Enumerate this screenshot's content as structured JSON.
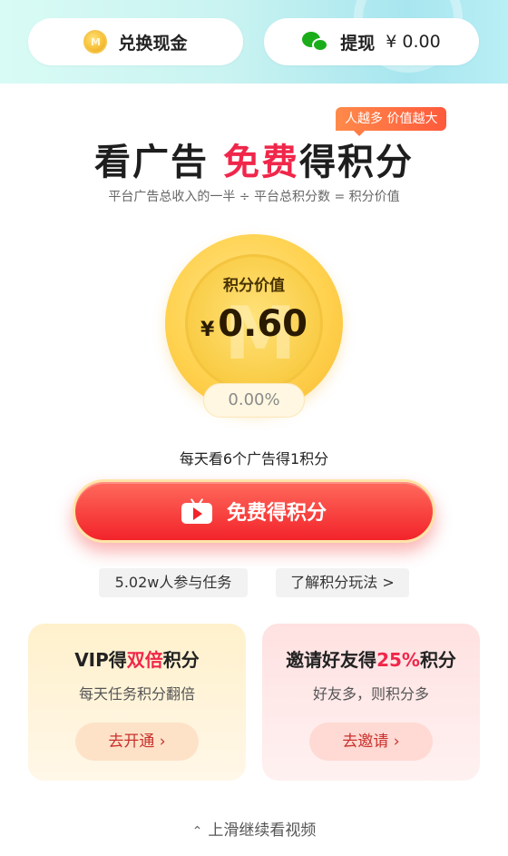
{
  "header": {
    "exchange_cash": {
      "label": "兑换现金",
      "icon": "coin-icon"
    },
    "withdraw": {
      "label": "提现",
      "amount": "¥ 0.00",
      "icon": "wechat-icon"
    }
  },
  "hero": {
    "tag": "人越多 价值越大",
    "title_part1": "看广告 ",
    "title_highlight": "免费",
    "title_part2": "得积分",
    "formula": "平台广告总收入的一半 ÷ 平台总积分数 = 积分价值",
    "coin_label": "积分价值",
    "currency_symbol": "¥",
    "points_value": "0.60",
    "change_percent": "0.00%"
  },
  "task": {
    "subtitle": "每天看6个广告得1积分",
    "cta_label": "免费得积分",
    "cta_icon": "tv-play-icon",
    "participants": "5.02w人参与任务",
    "learn_more": "了解积分玩法 >"
  },
  "cards": {
    "vip": {
      "title_prefix": "VIP得",
      "title_highlight": "双倍",
      "title_suffix": "积分",
      "desc": "每天任务积分翻倍",
      "button": "去开通 ›"
    },
    "invite": {
      "title_prefix": "邀请好友得",
      "title_highlight": "25%",
      "title_suffix": "积分",
      "desc": "好友多，则积分多",
      "button": "去邀请 ›"
    }
  },
  "footer": {
    "swipe_hint": "上滑继续看视频",
    "swipe_icon": "double-chevron-up-icon"
  },
  "colors": {
    "accent_red": "#f0264a",
    "cta_red": "#f2232a",
    "coin_gold": "#f9cc45",
    "wechat_green": "#1aad19"
  }
}
